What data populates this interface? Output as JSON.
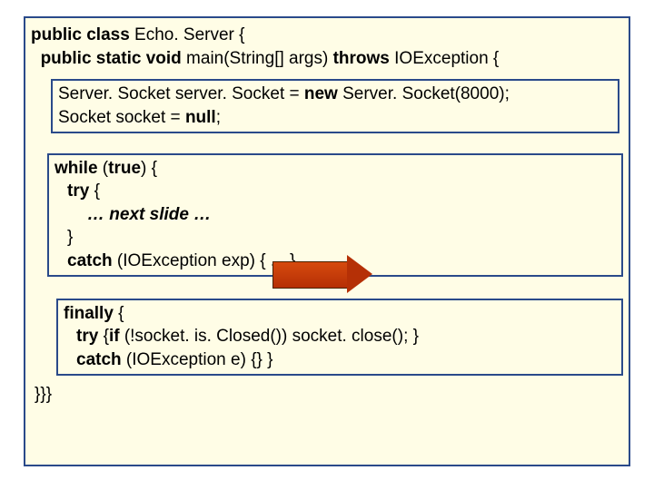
{
  "code": {
    "line1_pre": "public class",
    "line1_post": " Echo. Server {",
    "line2_a": "public static void",
    "line2_b": " main(String[] args) ",
    "line2_c": "throws",
    "line2_d": " IOException {",
    "box1_l1a": "Server. Socket server. Socket = ",
    "box1_l1b": "new",
    "box1_l1c": " Server. Socket(8000);",
    "box1_l2a": "Socket socket = ",
    "box1_l2b": "null",
    "box1_l2c": ";",
    "box2_l1a": "while",
    "box2_l1b": " (",
    "box2_l1c": "true",
    "box2_l1d": ") {",
    "box2_l2a": "try",
    "box2_l2b": " {",
    "box2_l3": "… next slide …",
    "box2_l4": "}",
    "box2_l5a": "catch",
    "box2_l5b": " (IOException exp) { ... }",
    "box3_l1a": "finally",
    "box3_l1b": " {",
    "box3_l2a": "try ",
    "box3_l2b": "{",
    "box3_l2c": "if",
    "box3_l2d": " (!socket. is. Closed()) socket. close(); }",
    "box3_l3a": "catch",
    "box3_l3b": " (IOException e) {} }",
    "closing": "}}}"
  }
}
